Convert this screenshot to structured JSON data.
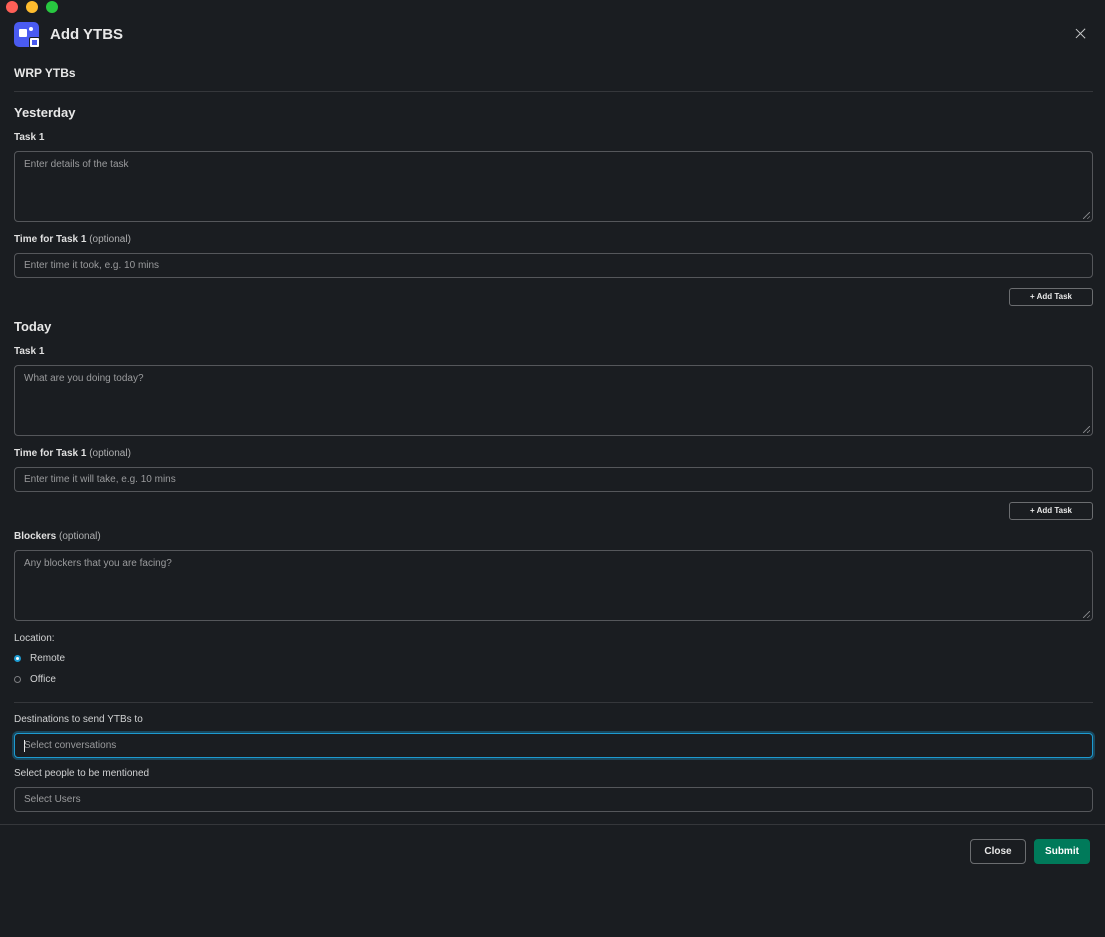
{
  "window": {
    "title": "Add YTBS",
    "close_icon": "close-icon",
    "app_icon": "app-logo-icon"
  },
  "form": {
    "section_title": "WRP YTBs",
    "yesterday": {
      "heading": "Yesterday",
      "task_label": "Task 1",
      "task_placeholder": "Enter details of the task",
      "time_label": "Time for Task 1",
      "time_optional": "(optional)",
      "time_placeholder": "Enter time it took, e.g. 10 mins",
      "add_task": "+ Add Task"
    },
    "today": {
      "heading": "Today",
      "task_label": "Task 1",
      "task_placeholder": "What are you doing today?",
      "time_label": "Time for Task 1",
      "time_optional": "(optional)",
      "time_placeholder": "Enter time it will take, e.g. 10 mins",
      "add_task": "+ Add Task"
    },
    "blockers": {
      "label": "Blockers",
      "optional": "(optional)",
      "placeholder": "Any blockers that you are facing?"
    },
    "location": {
      "label": "Location:",
      "options": [
        {
          "label": "Remote",
          "checked": true
        },
        {
          "label": "Office",
          "checked": false
        }
      ]
    },
    "destinations": {
      "label": "Destinations to send YTBs to",
      "placeholder": "Select conversations"
    },
    "mentions": {
      "label": "Select people to be mentioned",
      "placeholder": "Select Users"
    }
  },
  "footer": {
    "close_label": "Close",
    "submit_label": "Submit"
  },
  "colors": {
    "background": "#1a1d21",
    "border": "#55575b",
    "focus": "#1d9bd1",
    "submit": "#007a5a",
    "app_icon": "#4a5bf0"
  }
}
